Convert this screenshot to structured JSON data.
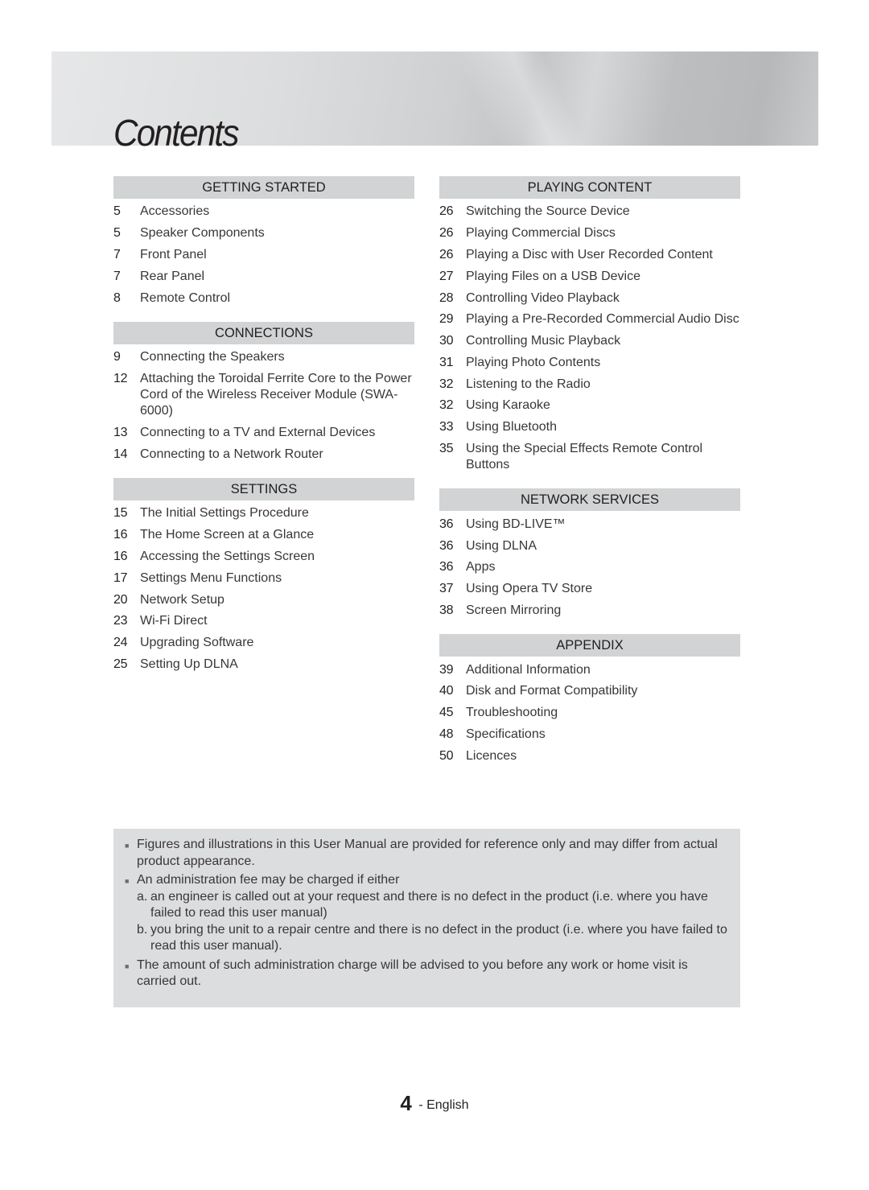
{
  "page_title": "Contents",
  "columns": {
    "left": [
      {
        "header": "GETTING STARTED",
        "entries": [
          {
            "page": "5",
            "title": "Accessories"
          },
          {
            "page": "5",
            "title": "Speaker Components"
          },
          {
            "page": "7",
            "title": "Front Panel"
          },
          {
            "page": "7",
            "title": "Rear Panel"
          },
          {
            "page": "8",
            "title": "Remote Control"
          }
        ]
      },
      {
        "header": "CONNECTIONS",
        "entries": [
          {
            "page": "9",
            "title": "Connecting the Speakers"
          },
          {
            "page": "12",
            "title": "Attaching the Toroidal Ferrite Core to the Power Cord of the Wireless Receiver Module (SWA-6000)"
          },
          {
            "page": "13",
            "title": "Connecting to a TV and External Devices"
          },
          {
            "page": "14",
            "title": "Connecting to a Network Router"
          }
        ]
      },
      {
        "header": "SETTINGS",
        "entries": [
          {
            "page": "15",
            "title": "The Initial Settings Procedure"
          },
          {
            "page": "16",
            "title": "The Home Screen at a Glance"
          },
          {
            "page": "16",
            "title": "Accessing the Settings Screen"
          },
          {
            "page": "17",
            "title": "Settings Menu Functions"
          },
          {
            "page": "20",
            "title": "Network Setup"
          },
          {
            "page": "23",
            "title": "Wi-Fi Direct"
          },
          {
            "page": "24",
            "title": "Upgrading Software"
          },
          {
            "page": "25",
            "title": "Setting Up DLNA"
          }
        ]
      }
    ],
    "right": [
      {
        "header": "PLAYING CONTENT",
        "entries": [
          {
            "page": "26",
            "title": "Switching the Source Device"
          },
          {
            "page": "26",
            "title": "Playing Commercial Discs"
          },
          {
            "page": "26",
            "title": "Playing a Disc with User Recorded Content"
          },
          {
            "page": "27",
            "title": "Playing Files on a USB Device"
          },
          {
            "page": "28",
            "title": "Controlling Video Playback"
          },
          {
            "page": "29",
            "title": "Playing a Pre-Recorded Commercial Audio Disc"
          },
          {
            "page": "30",
            "title": "Controlling Music Playback"
          },
          {
            "page": "31",
            "title": "Playing Photo Contents"
          },
          {
            "page": "32",
            "title": "Listening to the Radio"
          },
          {
            "page": "32",
            "title": "Using Karaoke"
          },
          {
            "page": "33",
            "title": "Using Bluetooth"
          },
          {
            "page": "35",
            "title": "Using the Special Effects Remote Control Buttons"
          }
        ]
      },
      {
        "header": "NETWORK SERVICES",
        "entries": [
          {
            "page": "36",
            "title": "Using BD-LIVE™"
          },
          {
            "page": "36",
            "title": "Using DLNA"
          },
          {
            "page": "36",
            "title": "Apps"
          },
          {
            "page": "37",
            "title": "Using Opera TV Store"
          },
          {
            "page": "38",
            "title": "Screen Mirroring"
          }
        ]
      },
      {
        "header": "APPENDIX",
        "entries": [
          {
            "page": "39",
            "title": "Additional Information"
          },
          {
            "page": "40",
            "title": "Disk and Format Compatibility"
          },
          {
            "page": "45",
            "title": "Troubleshooting"
          },
          {
            "page": "48",
            "title": "Specifications"
          },
          {
            "page": "50",
            "title": "Licences"
          }
        ]
      }
    ]
  },
  "notes": {
    "bullet_icon": "small-square-bullet",
    "items": [
      {
        "text": "Figures and illustrations in this User Manual are provided for reference only and may differ from actual product appearance.",
        "sub": []
      },
      {
        "text": "An administration fee may be charged if either",
        "sub": [
          {
            "label": "a.",
            "text": "an engineer is called out at your request and there is no defect in the product (i.e. where you have failed to read this user manual)"
          },
          {
            "label": "b.",
            "text": "you bring the unit to a repair centre and there is no defect in the product (i.e. where you have failed to read this user manual)."
          }
        ]
      },
      {
        "text": "The amount of such administration charge will be advised to you before any work or home visit is carried out.",
        "sub": []
      }
    ]
  },
  "footer": {
    "page_number": "4",
    "separator": " - ",
    "language": "English"
  }
}
